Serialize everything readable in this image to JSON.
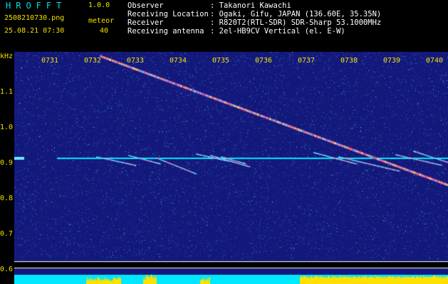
{
  "header": {
    "app_title": "HROFFT",
    "app_version": "1.0.0",
    "file_name": "2508210730.png",
    "meteor_label": "meteor",
    "timestamp": "25.08.21 07:30",
    "meteor_count": "40"
  },
  "info": [
    {
      "label": "Observer",
      "value": ": Takanori Kawachi"
    },
    {
      "label": "Receiving Location",
      "value": ": Ogaki, Gifu, JAPAN (136.60E, 35.35N)"
    },
    {
      "label": "Receiver",
      "value": ": R820T2(RTL-SDR) SDR-Sharp 53.1000MHz"
    },
    {
      "label": "Receiving antenna",
      "value": ": 2el-HB9CV Vertical (el. E-W)"
    }
  ],
  "axis": {
    "y_unit": "kHz",
    "x_ticks": [
      "0731",
      "0732",
      "0733",
      "0734",
      "0735",
      "0736",
      "0737",
      "0738",
      "0739",
      "0740"
    ],
    "y_ticks": [
      "1.1",
      "1.0",
      "0.9",
      "0.8",
      "0.7",
      "0.6"
    ]
  },
  "colors": {
    "background": "#000000",
    "text_yellow": "#f0e000",
    "title_cyan": "#00e0e0",
    "spectrum_bg": "#13197a",
    "carrier": "#00e6ff",
    "meteor_trace": "#ff5aa0",
    "level_yellow": "#ffe000",
    "level_cyan": "#00e8ff"
  }
}
